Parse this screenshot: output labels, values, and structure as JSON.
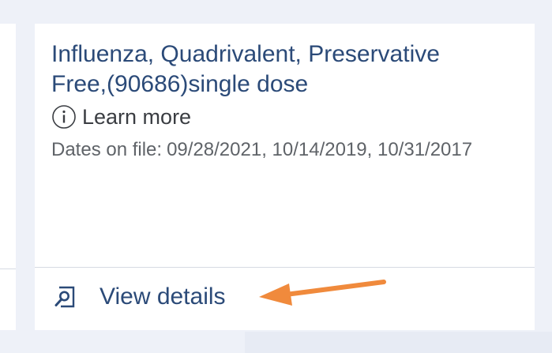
{
  "card": {
    "title": "Influenza, Quadrivalent, Preservative Free,(90686)single dose",
    "learn_more_label": "Learn more",
    "learn_more_icon": "info-icon",
    "dates_label": "Dates on file:",
    "dates_value": "09/28/2021, 10/14/2019, 10/31/2017",
    "view_details_label": "View details",
    "view_details_icon": "search-document-icon"
  },
  "colors": {
    "page_background": "#eef1f8",
    "card_background": "#ffffff",
    "title_text": "#2b4a78",
    "link_text": "#2b4a78",
    "body_text": "#5f6368",
    "annotation_arrow": "#f08a3c"
  }
}
